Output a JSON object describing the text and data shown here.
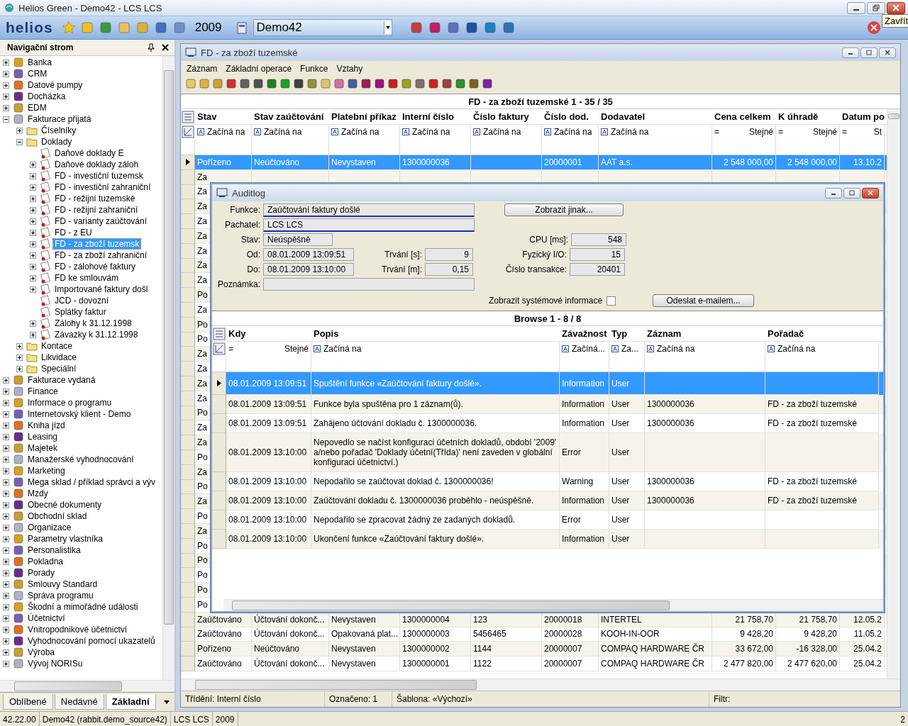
{
  "window": {
    "title": "Helios Green - Demo42 - LCS LCS",
    "tooltip": "Zavřít"
  },
  "toolbar": {
    "logo": "helios",
    "year": "2009",
    "database": "Demo42"
  },
  "navigation": {
    "title": "Navigační strom",
    "items": [
      {
        "label": "Banka",
        "expanded": false,
        "selected": false
      },
      {
        "label": "CRM",
        "expanded": false,
        "selected": false
      },
      {
        "label": "Datové pumpy",
        "expanded": false,
        "selected": false
      },
      {
        "label": "Docházka",
        "expanded": false,
        "selected": false
      },
      {
        "label": "EDM",
        "expanded": false,
        "selected": false
      },
      {
        "label": "Fakturace přijatá",
        "expanded": true,
        "selected": false,
        "children": [
          {
            "label": "Číselníky",
            "expanded": false,
            "selected": false
          },
          {
            "label": "Doklady",
            "expanded": true,
            "selected": false,
            "children": [
              {
                "label": "Daňové doklady E",
                "selected": false
              },
              {
                "label": "Daňové doklady záloh",
                "expanded": false,
                "selected": false
              },
              {
                "label": "FD - investiční tuzemsk",
                "expanded": false,
                "selected": false
              },
              {
                "label": "FD - investiční zahraniční",
                "expanded": false,
                "selected": false
              },
              {
                "label": "FD - režijní tuzemské",
                "expanded": false,
                "selected": false
              },
              {
                "label": "FD - režijní zahraniční",
                "expanded": false,
                "selected": false
              },
              {
                "label": "FD - varianty zaúčtování",
                "expanded": false,
                "selected": false
              },
              {
                "label": "FD - z EU",
                "expanded": false,
                "selected": false
              },
              {
                "label": "FD - za zboží tuzemsk",
                "expanded": false,
                "selected": true
              },
              {
                "label": "FD - za zboží zahraniční",
                "expanded": false,
                "selected": false
              },
              {
                "label": "FD - zálohové faktury",
                "expanded": false,
                "selected": false
              },
              {
                "label": "FD ke smlouvám",
                "expanded": false,
                "selected": false
              },
              {
                "label": "Importované faktury došl",
                "expanded": false,
                "selected": false
              },
              {
                "label": "JCD - dovozní",
                "selected": false
              },
              {
                "label": "Splátky faktur",
                "selected": false
              },
              {
                "label": "Zálohy k 31.12.1998",
                "expanded": false,
                "selected": false
              },
              {
                "label": "Závazky k 31.12.1998",
                "expanded": false,
                "selected": false
              }
            ]
          },
          {
            "label": "Kontace",
            "expanded": false,
            "selected": false
          },
          {
            "label": "Likvidace",
            "expanded": false,
            "selected": false
          },
          {
            "label": "Speciální",
            "expanded": false,
            "selected": false
          }
        ]
      },
      {
        "label": "Fakturace vydaná",
        "expanded": false,
        "selected": false
      },
      {
        "label": "Finance",
        "expanded": false,
        "selected": false
      },
      {
        "label": "Informace o programu",
        "expanded": false,
        "selected": false
      },
      {
        "label": "Internetovský klient - Demo",
        "expanded": false,
        "selected": false
      },
      {
        "label": "Kniha jízd",
        "expanded": false,
        "selected": false
      },
      {
        "label": "Leasing",
        "expanded": false,
        "selected": false
      },
      {
        "label": "Majetek",
        "expanded": false,
        "selected": false
      },
      {
        "label": "Manažerské vyhodnocování",
        "expanded": false,
        "selected": false
      },
      {
        "label": "Marketing",
        "expanded": false,
        "selected": false
      },
      {
        "label": "Mega sklad / příklad správci a výv",
        "expanded": false,
        "selected": false
      },
      {
        "label": "Mzdy",
        "expanded": false,
        "selected": false
      },
      {
        "label": "Obecné dokumenty",
        "expanded": false,
        "selected": false
      },
      {
        "label": "Obchodní sklad",
        "expanded": false,
        "selected": false
      },
      {
        "label": "Organizace",
        "expanded": false,
        "selected": false
      },
      {
        "label": "Parametry vlastníka",
        "expanded": false,
        "selected": false
      },
      {
        "label": "Personalistika",
        "expanded": false,
        "selected": false
      },
      {
        "label": "Pokladna",
        "expanded": false,
        "selected": false
      },
      {
        "label": "Porady",
        "expanded": false,
        "selected": false
      },
      {
        "label": "Smlouvy Standard",
        "expanded": false,
        "selected": false
      },
      {
        "label": "Správa programu",
        "expanded": false,
        "selected": false
      },
      {
        "label": "Škodní a mimořádné události",
        "expanded": false,
        "selected": false
      },
      {
        "label": "Účetnictví",
        "expanded": false,
        "selected": false
      },
      {
        "label": "Vnitropodnikové účetnictví",
        "expanded": false,
        "selected": false
      },
      {
        "label": "Vyhodnocování pomocí ukazatelů",
        "expanded": false,
        "selected": false
      },
      {
        "label": "Výroba",
        "expanded": false,
        "selected": false
      },
      {
        "label": "Vývoj NORISu",
        "expanded": false,
        "selected": false
      }
    ],
    "tabs": [
      {
        "label": "Oblíbené",
        "selected": false
      },
      {
        "label": "Nedávné",
        "selected": false
      },
      {
        "label": "Základní",
        "selected": true
      }
    ]
  },
  "document_window": {
    "title": "FD - za zboží tuzemské",
    "menu": [
      "Záznam",
      "Základní operace",
      "Funkce",
      "Vztahy"
    ],
    "grid": {
      "title": "FD - za zboží tuzemské  1 - 35 / 35",
      "columns": [
        {
          "label": "Stav",
          "filter": {
            "kind": "text",
            "label": "Začíná na"
          }
        },
        {
          "label": "Stav zaúčtování",
          "filter": {
            "kind": "text",
            "label": "Začíná na"
          }
        },
        {
          "label": "Platební příkaz",
          "filter": {
            "kind": "text",
            "label": "Začíná na"
          }
        },
        {
          "label": "Interní číslo",
          "filter": {
            "kind": "text",
            "label": "Začíná na"
          }
        },
        {
          "label": "Číslo faktury",
          "filter": {
            "kind": "text",
            "label": "Začíná na"
          }
        },
        {
          "label": "Číslo dod.",
          "filter": {
            "kind": "text",
            "label": "Začíná na"
          }
        },
        {
          "label": "Dodavatel",
          "filter": {
            "kind": "text",
            "label": "Začíná na"
          }
        },
        {
          "label": "Cena celkem",
          "filter": {
            "kind": "equal",
            "sign": "=",
            "label": "Stejné"
          }
        },
        {
          "label": "K úhradě",
          "filter": {
            "kind": "equal",
            "sign": "=",
            "label": "Stejné"
          }
        },
        {
          "label": "Datum po",
          "filter": {
            "kind": "equal",
            "sign": "=",
            "label": "St"
          }
        }
      ],
      "rows": [
        {
          "selected": true,
          "cells": [
            "Pořízeno",
            "Neúčtováno",
            "Nevystaven",
            "1300000036",
            "",
            "20000001",
            "AAT a.s.",
            "2 548 000,00",
            "2 548 000,00",
            "13.10.2"
          ]
        },
        {
          "selected": false,
          "cells": [
            "Za"
          ]
        },
        {
          "selected": false,
          "cells": [
            "Za"
          ]
        },
        {
          "selected": false,
          "cells": [
            "Za"
          ]
        },
        {
          "selected": false,
          "cells": [
            "Za"
          ]
        },
        {
          "selected": false,
          "cells": [
            "Za"
          ]
        },
        {
          "selected": false,
          "cells": [
            "Za"
          ]
        },
        {
          "selected": false,
          "cells": [
            "Za"
          ]
        },
        {
          "selected": false,
          "cells": [
            "Za"
          ]
        },
        {
          "selected": false,
          "cells": [
            "Po"
          ]
        },
        {
          "selected": false,
          "cells": [
            "Za"
          ]
        },
        {
          "selected": false,
          "cells": [
            "Po"
          ]
        },
        {
          "selected": false,
          "cells": [
            "Po"
          ]
        },
        {
          "selected": false,
          "cells": [
            "Za"
          ]
        },
        {
          "selected": false,
          "cells": [
            "Za"
          ]
        },
        {
          "selected": false,
          "cells": [
            "Za"
          ]
        },
        {
          "selected": false,
          "cells": [
            "Za"
          ]
        },
        {
          "selected": false,
          "cells": [
            "Po"
          ]
        },
        {
          "selected": false,
          "cells": [
            "Za"
          ]
        },
        {
          "selected": false,
          "cells": [
            "Za"
          ]
        },
        {
          "selected": false,
          "cells": [
            "Po"
          ]
        },
        {
          "selected": false,
          "cells": [
            "Za"
          ]
        },
        {
          "selected": false,
          "cells": [
            "Po"
          ]
        },
        {
          "selected": false,
          "cells": [
            "Za"
          ]
        },
        {
          "selected": false,
          "cells": [
            "Po"
          ]
        },
        {
          "selected": false,
          "cells": [
            "Za"
          ]
        },
        {
          "selected": false,
          "cells": [
            "Po"
          ]
        },
        {
          "selected": false,
          "cells": [
            "Po"
          ]
        },
        {
          "selected": false,
          "cells": [
            "Po"
          ]
        },
        {
          "selected": false,
          "cells": [
            "Po"
          ]
        },
        {
          "selected": false,
          "cells": [
            "Po"
          ]
        },
        {
          "selected": false,
          "cells": [
            "Zaúčtováno",
            "Účtování dokonč...",
            "Nevystaven",
            "1300000004",
            "123",
            "20000018",
            "INTERTEL",
            "21 758,70",
            "21 758,70",
            "12.05.2"
          ]
        },
        {
          "selected": false,
          "cells": [
            "Zaúčtováno",
            "Účtování dokonč...",
            "Opakovaná plat...",
            "1300000003",
            "5456465",
            "20000028",
            "KOOH-IN-OOR",
            "9 428,20",
            "9 428,20",
            "11.05.2"
          ]
        },
        {
          "selected": false,
          "cells": [
            "Pořízeno",
            "Neúčtováno",
            "Nevystaven",
            "1300000002",
            "1144",
            "20000007",
            "COMPAQ HARDWARE ČR",
            "33 672,00",
            "-16 328,00",
            "25.04.2"
          ]
        },
        {
          "selected": false,
          "cells": [
            "Zaúčtováno",
            "Účtování dokonč...",
            "Nevystaven",
            "1300000001",
            "1122",
            "20000007",
            "COMPAQ HARDWARE ČR",
            "2 477 820,00",
            "2 477 620,00",
            "25.04.2"
          ]
        }
      ]
    },
    "status": [
      "Třídění: Interní číslo",
      "Označeno: 1",
      "Šablona: «Výchozí»",
      "Filtr:"
    ]
  },
  "auditlog": {
    "title": "Auditlog",
    "function": {
      "label": "Funkce:",
      "value": "Zaúčtování faktury došlé"
    },
    "culprit": {
      "label": "Pachatel:",
      "value": "LCS LCS"
    },
    "state": {
      "label": "Stav:",
      "value": "Neúspěšně"
    },
    "from": {
      "label": "Od:",
      "value": "08.01.2009 13:09:51"
    },
    "to": {
      "label": "Do:",
      "value": "08.01.2009 13:10:00"
    },
    "note": {
      "label": "Poznámka:"
    },
    "duration_s": {
      "label": "Trvání [s]:",
      "value": "9"
    },
    "duration_m": {
      "label": "Trvání [m]:",
      "value": "0,15"
    },
    "cpu": {
      "label": "CPU [ms]:",
      "value": "548"
    },
    "io": {
      "label": "Fyzický I/O:",
      "value": "15"
    },
    "transaction": {
      "label": "Číslo transakce:",
      "value": "20401"
    },
    "show_other_button": "Zobrazit jinak...",
    "system_info": {
      "label": "Zobrazit systémové informace",
      "checked": false
    },
    "email_button": "Odeslat e-mailem...",
    "grid": {
      "title": "Browse  1 - 8 / 8",
      "columns": [
        {
          "label": "Kdy",
          "filter": {
            "kind": "equal",
            "sign": "=",
            "label": "Stejné"
          }
        },
        {
          "label": "Popis",
          "filter": {
            "kind": "text",
            "label": "Začíná na"
          }
        },
        {
          "label": "Závažnost",
          "filter": {
            "kind": "text",
            "label": "Začíná..."
          }
        },
        {
          "label": "Typ",
          "filter": {
            "kind": "text",
            "label": "Za..."
          }
        },
        {
          "label": "Záznam",
          "filter": {
            "kind": "text",
            "label": "Začíná na"
          }
        },
        {
          "label": "Pořadač",
          "filter": {
            "kind": "text",
            "label": "Začíná na"
          }
        }
      ],
      "rows": [
        {
          "selected": true,
          "cells": [
            "08.01.2009 13:09:51",
            "Spuštění funkce «Zaúčtování faktury došlé».",
            "Information",
            "User",
            "",
            ""
          ]
        },
        {
          "selected": false,
          "cells": [
            "08.01.2009 13:09:51",
            "Funkce byla spuštěna pro 1 záznam(ů).",
            "Information",
            "User",
            "1300000036",
            "FD - za zboží tuzemské"
          ]
        },
        {
          "selected": false,
          "cells": [
            "08.01.2009 13:09:51",
            "Zahájeno účtování dokladu č. 1300000036.",
            "Information",
            "User",
            "1300000036",
            "FD - za zboží tuzemské"
          ]
        },
        {
          "selected": false,
          "cells": [
            "08.01.2009 13:10:00",
            "Nepovedlo se načíst konfiguraci účetních dokladů, období '2009' a/nebo pořadač 'Doklady účetní(Třída)' není zaveden v globální konfiguraci účetnictví.)",
            "Error",
            "User",
            "",
            ""
          ]
        },
        {
          "selected": false,
          "cells": [
            "08.01.2009 13:10:00",
            "Nepodařilo se zaúčtovat doklad č. 1300000036!",
            "Warning",
            "User",
            "1300000036",
            "FD - za zboží tuzemské"
          ]
        },
        {
          "selected": false,
          "cells": [
            "08.01.2009 13:10:00",
            "Zaúčtování dokladu č. 1300000036 proběhlo - neúspěšně.",
            "Information",
            "User",
            "1300000036",
            "FD - za zboží tuzemské"
          ]
        },
        {
          "selected": false,
          "cells": [
            "08.01.2009 13:10:00",
            "Nepodařilo se zpracovat žádný ze zadaných dokladů.",
            "Error",
            "User",
            "",
            ""
          ]
        },
        {
          "selected": false,
          "cells": [
            "08.01.2009 13:10:00",
            "Ukončení funkce «Zaúčtování faktury došlé».",
            "Information",
            "User",
            "",
            ""
          ]
        }
      ]
    }
  },
  "status_bar": [
    "42.22.00",
    "Demo42 (rabbit.demo_source42)",
    "LCS LCS",
    "2009",
    "2"
  ]
}
